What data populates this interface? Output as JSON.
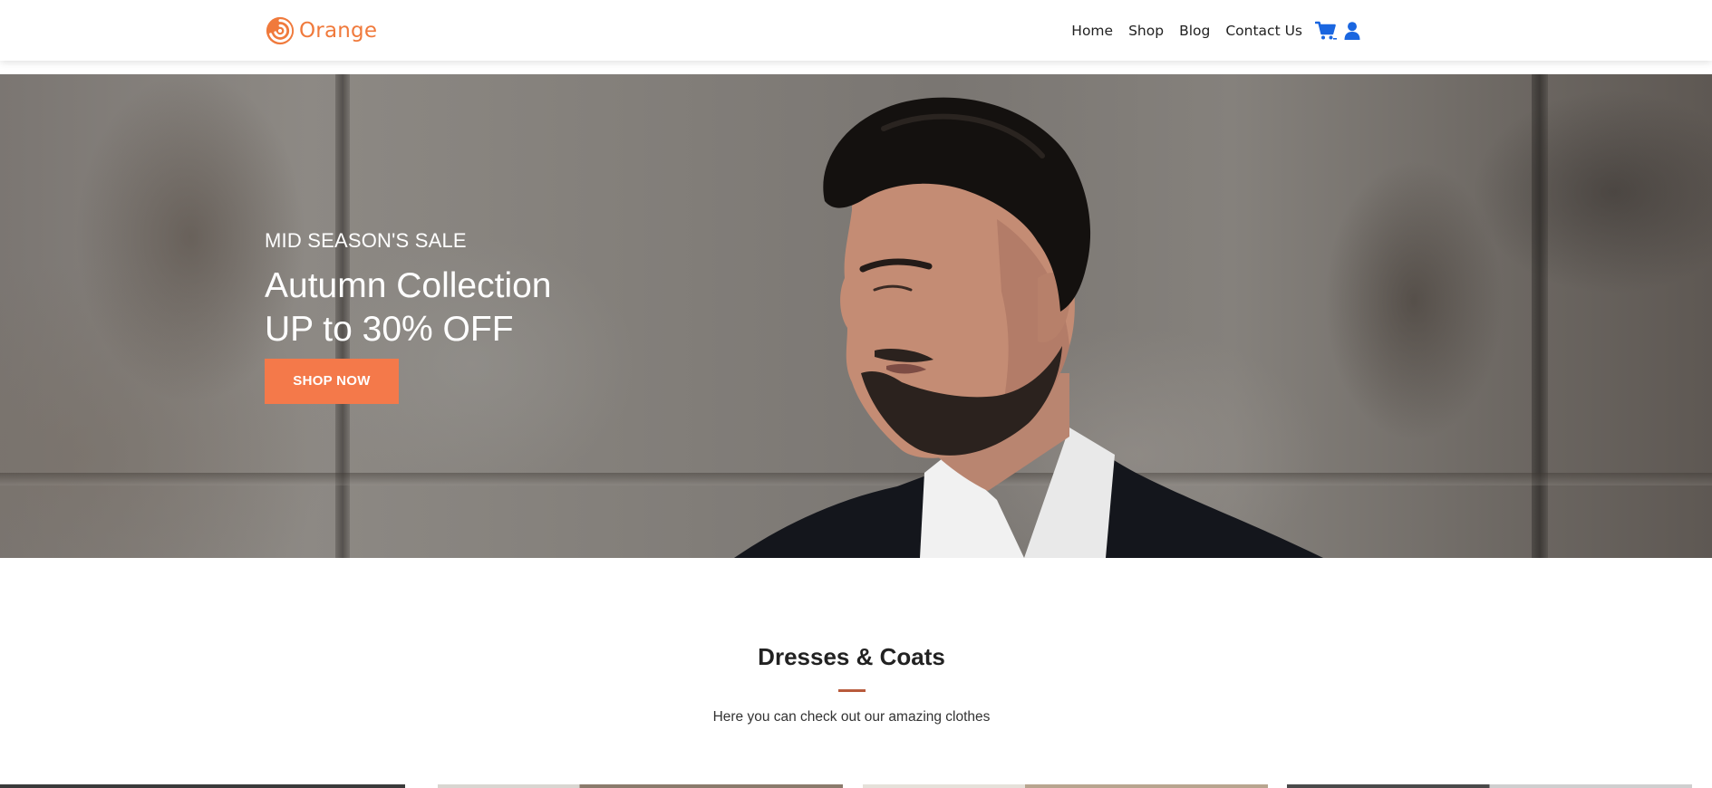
{
  "header": {
    "brand": "Orange",
    "nav": [
      "Home",
      "Shop",
      "Blog",
      "Contact Us"
    ],
    "icons": [
      "cart-icon",
      "user-icon"
    ]
  },
  "hero": {
    "eyebrow": "MID SEASON'S SALE",
    "title_line1": "Autumn Collection",
    "title_line2": "UP to 30% OFF",
    "cta": "SHOP NOW"
  },
  "section": {
    "title": "Dresses & Coats",
    "subtitle": "Here you can check out our amazing clothes"
  },
  "colors": {
    "brand": "#f07a3c",
    "cta": "#f4794a",
    "icon_blue": "#1a66e0",
    "underline": "#b85a3c"
  }
}
